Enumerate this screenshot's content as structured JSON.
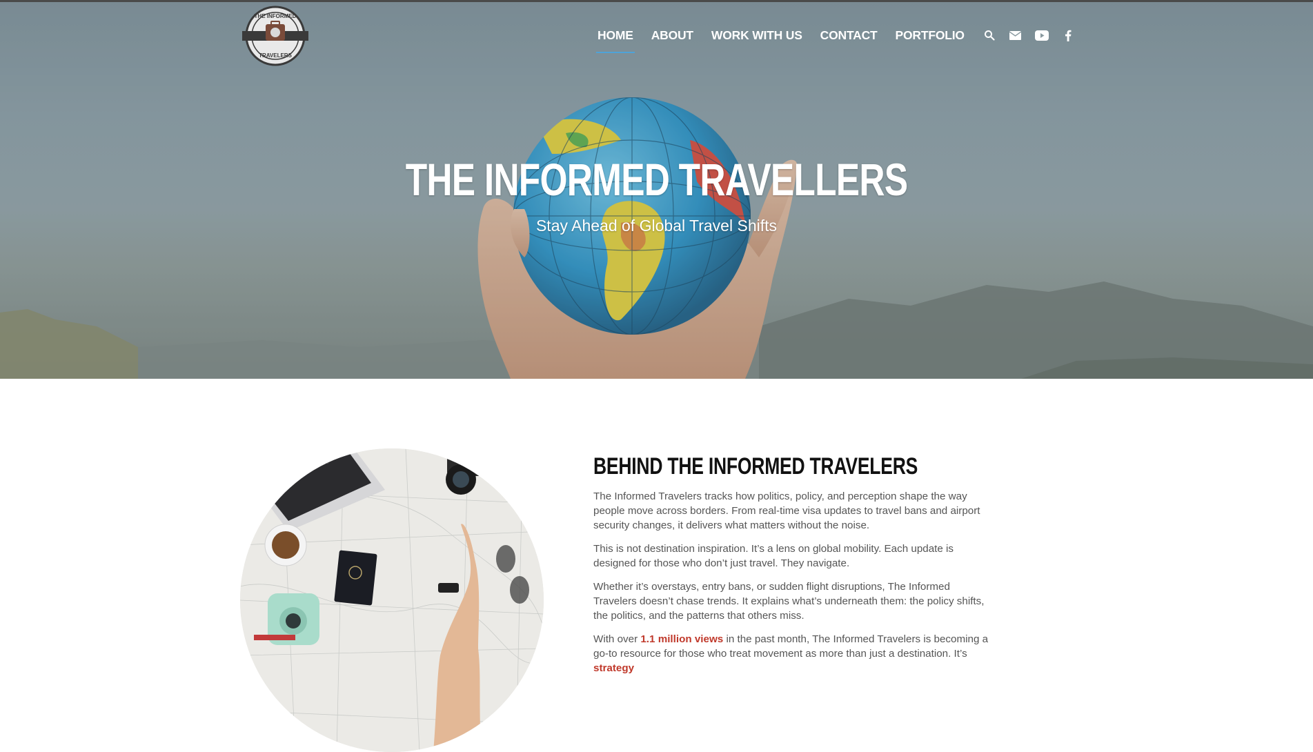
{
  "site": {
    "logo_alt": "THE INFORMED TRAVELERS",
    "logo_top_text": "THE INFORMED",
    "logo_bottom_text": "TRAVELERS"
  },
  "nav": {
    "items": [
      {
        "label": "HOME",
        "active": true
      },
      {
        "label": "ABOUT",
        "active": false
      },
      {
        "label": "WORK WITH US",
        "active": false
      },
      {
        "label": "CONTACT",
        "active": false
      },
      {
        "label": "PORTFOLIO",
        "active": false
      }
    ],
    "icons": [
      "search-icon",
      "mail-icon",
      "youtube-icon",
      "facebook-icon"
    ]
  },
  "hero": {
    "title": "THE INFORMED TRAVELLERS",
    "subtitle": "Stay Ahead of Global Travel Shifts"
  },
  "about": {
    "heading": "BEHIND THE INFORMED TRAVELERS",
    "p1": "The Informed Travelers tracks how politics, policy, and perception shape the way people move across borders. From real-time visa updates to travel bans and airport security changes, it delivers what matters without the noise.",
    "p2": "This is not destination inspiration. It’s a lens on global mobility. Each update is designed for those who don’t just travel. They navigate.",
    "p3": "Whether it’s overstays, entry bans, or sudden flight disruptions, The Informed Travelers doesn’t chase trends. It explains what’s underneath them: the policy shifts, the politics, and the patterns that others miss.",
    "p4_before": "With over ",
    "p4_highlight": "1.1 million views",
    "p4_after": " in the past month, The Informed Travelers is becoming a go-to resource for those who treat movement as more than just a destination. It’s ",
    "p4_highlight2": "strategy"
  },
  "colors": {
    "accent": "#4fa3d8",
    "highlight": "#c0392b",
    "heading": "#111111",
    "body_text": "#555555"
  }
}
